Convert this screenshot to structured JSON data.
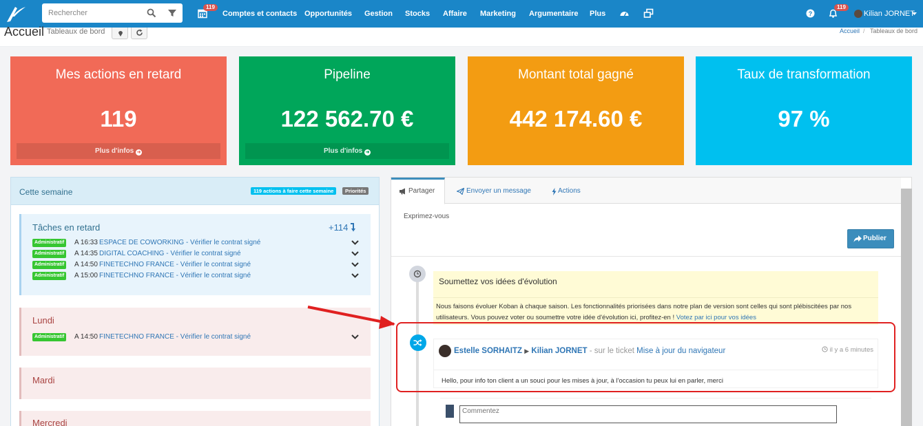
{
  "topbar": {
    "search_placeholder": "Rechercher",
    "calendar_badge": "119",
    "menu": [
      "Comptes et contacts",
      "Opportunités",
      "Gestion",
      "Stocks",
      "Affaire",
      "Marketing",
      "Argumentaire",
      "Plus"
    ],
    "notif_badge": "119",
    "user_name": "Kilian JORNET"
  },
  "page": {
    "title": "Accueil",
    "subtitle": "Tableaux de bord",
    "breadcrumb": [
      "Accueil",
      "Tableaux de bord"
    ]
  },
  "stats": [
    {
      "title": "Mes actions en retard",
      "value": "119",
      "more": "Plus d'infos",
      "color": "#f16a57"
    },
    {
      "title": "Pipeline",
      "value": "122 562.70 €",
      "more": "Plus d'infos",
      "color": "#00a65a"
    },
    {
      "title": "Montant total gagné",
      "value": "442 174.60 €",
      "more": "",
      "color": "#f39c12"
    },
    {
      "title": "Taux de transformation",
      "value": "97 %",
      "more": "",
      "color": "#00c0ef"
    }
  ],
  "week": {
    "title": "Cette semaine",
    "badge_actions": "119 actions à faire cette semaine",
    "badge_priorities": "Priorités",
    "late": {
      "title": "Tâches en retard",
      "count": "+114",
      "tasks": [
        {
          "tag": "Administratif",
          "time": "A 16:33",
          "text": "ESPACE DE COWORKING - Vérifier le contrat signé"
        },
        {
          "tag": "Administratif",
          "time": "A 14:35",
          "text": "DIGITAL COACHING - Vérifier le contrat signé"
        },
        {
          "tag": "Administratif",
          "time": "A 14:50",
          "text": "FINETECHNO FRANCE - Vérifier le contrat signé"
        },
        {
          "tag": "Administratif",
          "time": "A 15:00",
          "text": "FINETECHNO FRANCE - Vérifier le contrat signé"
        }
      ]
    },
    "days": [
      {
        "title": "Lundi",
        "tasks": [
          {
            "tag": "Administratif",
            "time": "A 14:50",
            "text": "FINETECHNO FRANCE - Vérifier le contrat signé"
          }
        ]
      },
      {
        "title": "Mardi",
        "tasks": []
      },
      {
        "title": "Mercredi",
        "tasks": []
      }
    ]
  },
  "feed": {
    "tabs": [
      "Partager",
      "Envoyer un message",
      "Actions"
    ],
    "prompt": "Exprimez-vous",
    "publish": "Publier",
    "note": {
      "title": "Soumettez vos idées d'évolution",
      "body": "Nous faisons évoluer Koban à chaque saison. Les fonctionnalités priorisées dans notre plan de version sont celles qui sont plébiscitées par nos utilisateurs. Vous pouvez voter ou soumettre votre idée d'évolution ici, profitez-en !",
      "link": "Votez par ici pour vos idées"
    },
    "post": {
      "author": "Estelle SORHAITZ",
      "target": "Kilian JORNET",
      "context": "- sur le ticket",
      "ticket": "Mise à jour du navigateur",
      "time": "il y a 6 minutes",
      "body": "Hello, pour info ton client a un souci pour les mises à jour, à l'occasion tu peux lui en parler, merci"
    },
    "comment_placeholder": "Commentez"
  }
}
